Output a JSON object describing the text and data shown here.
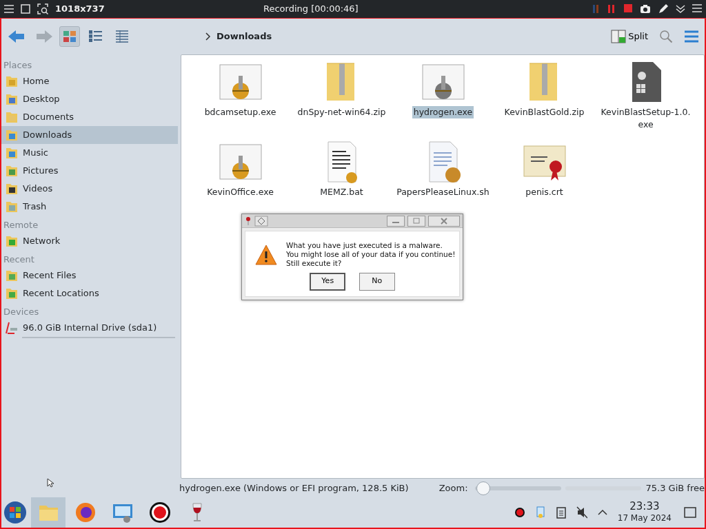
{
  "recorder_bar": {
    "size": "1018x737",
    "title": "Recording [00:00:46]"
  },
  "toolbar": {
    "view_modes": [
      {
        "kind": "icons",
        "selected": true
      },
      {
        "kind": "compact",
        "selected": false
      },
      {
        "kind": "details",
        "selected": false
      }
    ],
    "breadcrumb": "Downloads",
    "split": "Split"
  },
  "sidebar": [
    {
      "heading": "Places",
      "items": [
        {
          "label": "Home",
          "selected": false
        },
        {
          "label": "Desktop",
          "selected": false
        },
        {
          "label": "Documents",
          "selected": false
        },
        {
          "label": "Downloads",
          "selected": true
        },
        {
          "label": "Music",
          "selected": false
        },
        {
          "label": "Pictures",
          "selected": false
        },
        {
          "label": "Videos",
          "selected": false
        },
        {
          "label": "Trash",
          "selected": false
        }
      ]
    },
    {
      "heading": "Remote",
      "items": [
        {
          "label": "Network",
          "selected": false
        }
      ]
    },
    {
      "heading": "Recent",
      "items": [
        {
          "label": "Recent Files",
          "selected": false
        },
        {
          "label": "Recent Locations",
          "selected": false
        }
      ]
    },
    {
      "heading": "Devices",
      "items": [
        {
          "label": "96.0 GiB Internal Drive (sda1)",
          "selected": false,
          "kind": "drive"
        }
      ]
    }
  ],
  "files": [
    {
      "name": "bdcamsetup.exe",
      "kind": "exe",
      "selected": false
    },
    {
      "name": "dnSpy-net-win64.zip",
      "kind": "zip",
      "selected": false
    },
    {
      "name": "hydrogen.exe",
      "kind": "exe",
      "selected": true
    },
    {
      "name": "KevinBlastGold.zip",
      "kind": "zip",
      "selected": false
    },
    {
      "name": "KevinBlastSetup-1.0.exe",
      "kind": "setup",
      "selected": false
    },
    {
      "name": "KevinOffice.exe",
      "kind": "exe",
      "selected": false
    },
    {
      "name": "MEMZ.bat",
      "kind": "bat",
      "selected": false
    },
    {
      "name": "PapersPleaseLinux.sh",
      "kind": "script",
      "selected": false
    },
    {
      "name": "penis.crt",
      "kind": "cert",
      "selected": false
    }
  ],
  "dialog": {
    "message": [
      "What you have just executed is a malware.",
      "You might lose all of your data if you continue!",
      "Still execute it?"
    ],
    "buttons": [
      {
        "label": "Yes",
        "selected": true
      },
      {
        "label": "No",
        "selected": false
      }
    ]
  },
  "status_bar": {
    "info": "hydrogen.exe (Windows or EFI program, 128.5 KiB)",
    "zoom_label": "Zoom:",
    "zoom": {
      "level": 0.1
    },
    "free": "75.3 GiB free"
  },
  "taskbar": {
    "apps": [
      {
        "kind": "files",
        "selected": true
      },
      {
        "kind": "browser",
        "selected": false
      },
      {
        "kind": "remote",
        "selected": false
      },
      {
        "kind": "record",
        "selected": false
      },
      {
        "kind": "wine",
        "selected": false
      }
    ],
    "time": "23:33",
    "date": "17 May 2024"
  }
}
